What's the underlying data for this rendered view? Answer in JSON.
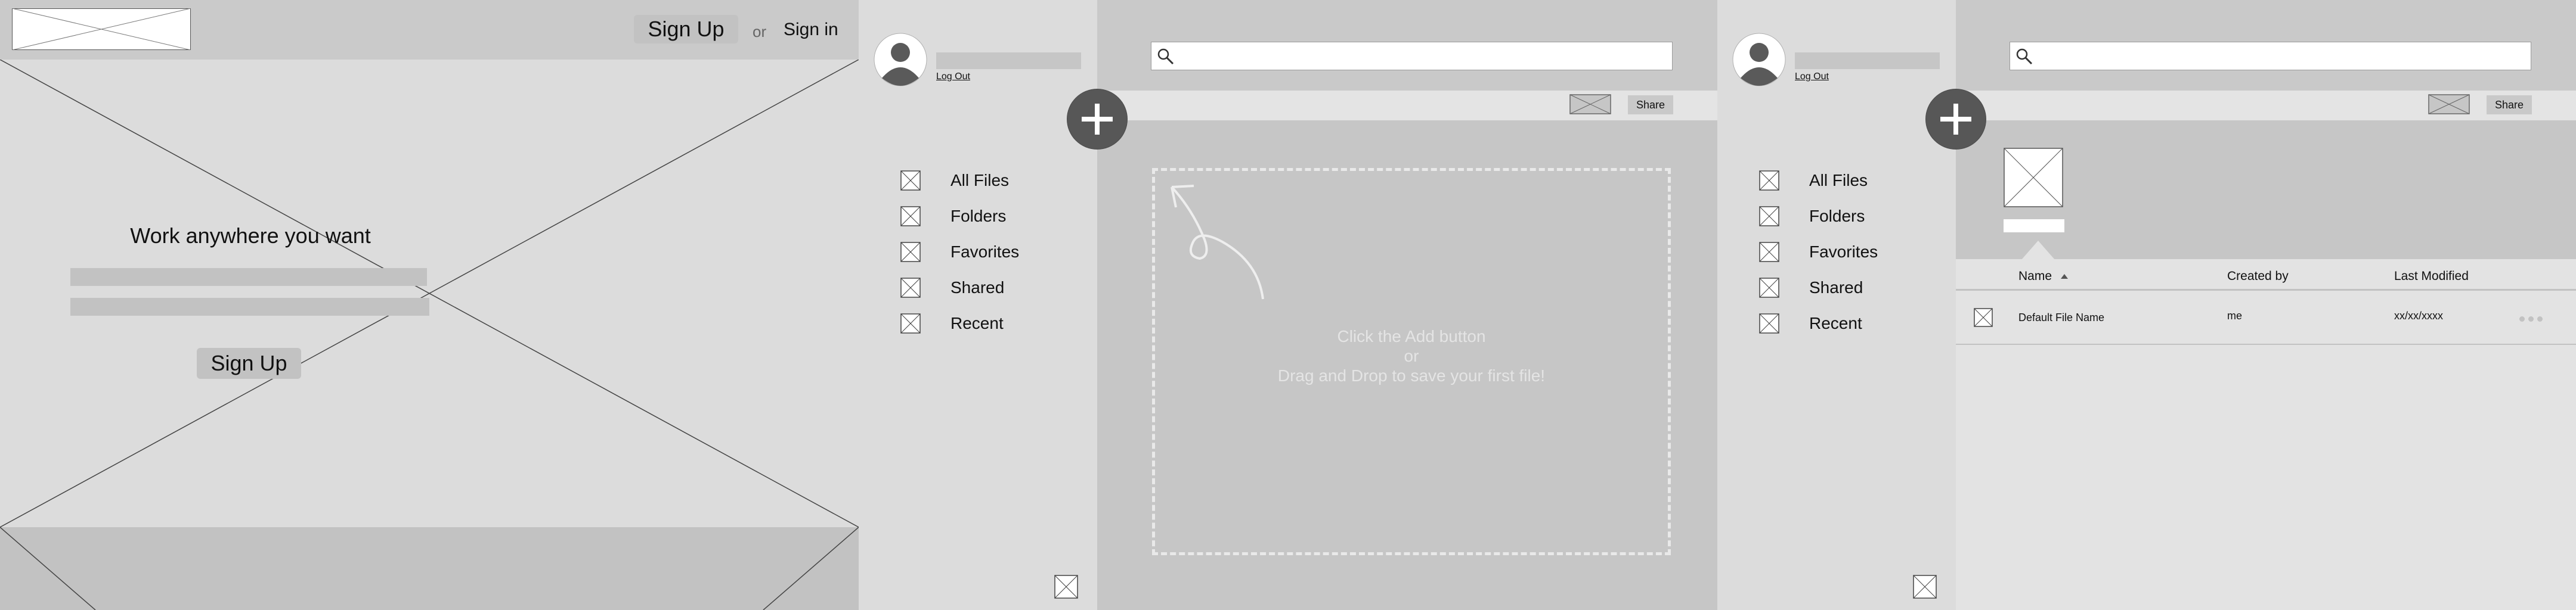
{
  "landing": {
    "header": {
      "signup_label": "Sign Up",
      "or_label": "or",
      "signin_label": "Sign in"
    },
    "hero": {
      "title": "Work anywhere you want",
      "signup_label": "Sign Up"
    }
  },
  "app_empty": {
    "sidebar": {
      "logout_label": "Log Out",
      "nav_items": [
        {
          "label": "All Files",
          "icon": "placeholder-icon"
        },
        {
          "label": "Folders",
          "icon": "placeholder-icon"
        },
        {
          "label": "Favorites",
          "icon": "placeholder-icon"
        },
        {
          "label": "Shared",
          "icon": "placeholder-icon"
        },
        {
          "label": "Recent",
          "icon": "placeholder-icon"
        }
      ]
    },
    "toolbar": {
      "share_label": "Share"
    },
    "empty_state": {
      "line1": "Click the Add button",
      "line2": "or",
      "line3": "Drag and Drop to save your first file!"
    }
  },
  "app_files": {
    "sidebar": {
      "logout_label": "Log Out",
      "nav_items": [
        {
          "label": "All Files",
          "icon": "placeholder-icon"
        },
        {
          "label": "Folders",
          "icon": "placeholder-icon"
        },
        {
          "label": "Favorites",
          "icon": "placeholder-icon"
        },
        {
          "label": "Shared",
          "icon": "placeholder-icon"
        },
        {
          "label": "Recent",
          "icon": "placeholder-icon"
        }
      ]
    },
    "toolbar": {
      "share_label": "Share"
    },
    "table": {
      "columns": [
        "Name",
        "Created by",
        "Last Modified"
      ],
      "sort_column": "Name",
      "rows": [
        {
          "name": "Default File Name",
          "created_by": "me",
          "last_modified": "xx/xx/xxxx"
        }
      ]
    }
  },
  "colors": {
    "wire_dark": "#575757",
    "wire_mid": "#c6c6c6",
    "wire_light": "#dcdcdc"
  }
}
